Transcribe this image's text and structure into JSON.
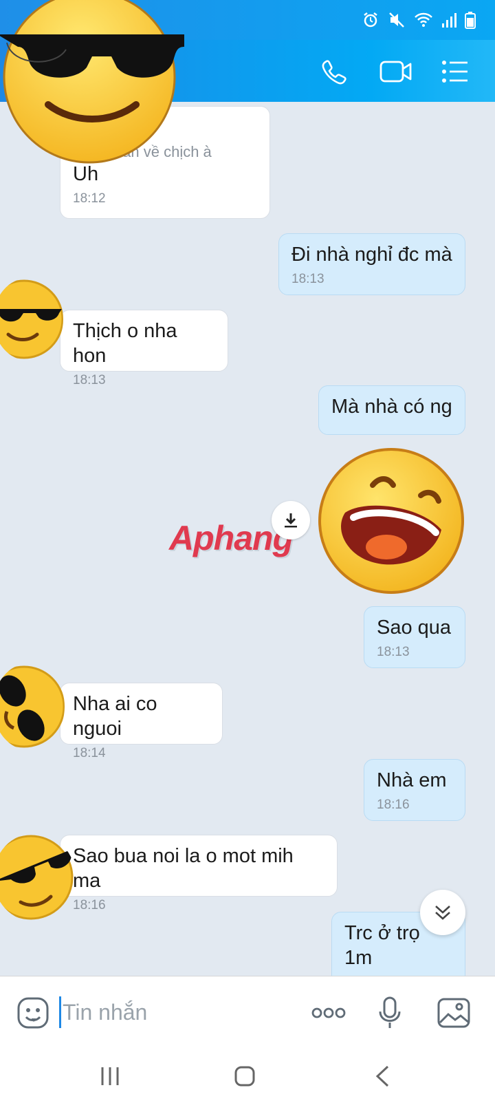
{
  "status_bar": {
    "icons": [
      "alarm-icon",
      "mute-icon",
      "wifi-icon",
      "signal-icon",
      "battery-icon"
    ]
  },
  "header": {
    "actions": [
      "phone-icon",
      "video-call-icon",
      "menu-list-icon"
    ]
  },
  "messages": [
    {
      "side": "in",
      "quote": "...keu dẫn về chịch à",
      "text": "Uh",
      "time": "18:12"
    },
    {
      "side": "out",
      "text": "Đi nhà nghỉ đc mà",
      "time": "18:13"
    },
    {
      "side": "in",
      "text": "Thịch o nha hon",
      "time": "18:13"
    },
    {
      "side": "out",
      "text": "Mà nhà có ng"
    },
    {
      "side": "out",
      "sticker": "laughing-face-sticker"
    },
    {
      "side": "out",
      "text": "Sao qua",
      "time": "18:13"
    },
    {
      "side": "in",
      "text": "Nha ai co nguoi",
      "time": "18:14"
    },
    {
      "side": "out",
      "text": "Nhà em",
      "time": "18:16"
    },
    {
      "side": "in",
      "text": "Sao bua noi la o mot mih ma",
      "time": "18:16"
    },
    {
      "side": "out",
      "text": "Trc ở trọ 1m"
    }
  ],
  "watermark": "Aphang",
  "composer": {
    "placeholder": "Tin nhắn"
  },
  "colors": {
    "accent": "#0aa7f3",
    "incoming": "#ffffff",
    "outgoing": "#d5ecfc",
    "background": "#e2e9f1"
  }
}
